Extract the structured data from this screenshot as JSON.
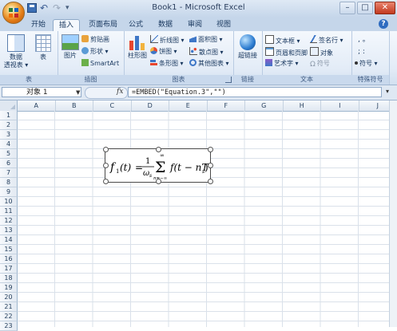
{
  "window": {
    "title": "Book1 - Microsoft Excel",
    "min": "–",
    "max": "□",
    "close": "✕"
  },
  "qat": {
    "undo": "↶",
    "redo": "↷",
    "more": "▾"
  },
  "tabs": [
    "开始",
    "插入",
    "页面布局",
    "公式",
    "数据",
    "审阅",
    "视图"
  ],
  "active_tab": "插入",
  "help": "?",
  "ribbon": {
    "groups": {
      "table": {
        "label": "表",
        "pivot": "数据\n透视表",
        "pivot_line1": "数据",
        "pivot_line2": "透视表 ▾",
        "table": "表"
      },
      "illustrations": {
        "label": "插图",
        "picture": "图片",
        "clipart": "剪贴画",
        "shapes": "形状 ▾",
        "smartart": "SmartArt"
      },
      "charts": {
        "label": "图表",
        "column": "柱形图",
        "line": "折线图 ▾",
        "pie": "饼图 ▾",
        "bar": "条形图 ▾",
        "area": "面积图 ▾",
        "scatter": "散点图 ▾",
        "other": "其他图表 ▾"
      },
      "links": {
        "label": "链接",
        "hyperlink": "超链接"
      },
      "text": {
        "label": "文本",
        "textbox": "文本框 ▾",
        "header_footer": "页眉和页脚",
        "wordart": "艺术字 ▾",
        "signature": "签名行 ▾",
        "object": "对象",
        "symbol": "符号"
      },
      "special": {
        "label": "特殊符号",
        "row1": ",  。",
        "row2": ";  :",
        "more": "符号 ▾"
      }
    }
  },
  "formula_bar": {
    "name_box": "对象 1",
    "fx": "fx",
    "formula": "=EMBED(\"Equation.3\",\"\")",
    "expand": "▾"
  },
  "sheet": {
    "columns": [
      "A",
      "B",
      "C",
      "D",
      "E",
      "F",
      "G",
      "H",
      "I",
      "J"
    ],
    "rows": [
      "1",
      "2",
      "3",
      "4",
      "5",
      "6",
      "7",
      "8",
      "9",
      "10",
      "11",
      "12",
      "13",
      "14",
      "15",
      "16",
      "17",
      "18",
      "19",
      "20",
      "21",
      "22",
      "23"
    ]
  },
  "equation": {
    "f": "f",
    "sub1": "1",
    "t_open": "(t)",
    "eq": "=",
    "num": "1",
    "omega": "ω",
    "sub_s": "s",
    "sigma": "Σ",
    "sum_top": "∞",
    "sum_bottom": "n=−∞",
    "body": "f(t − nT",
    "body_sub": "s",
    "body_close": ")"
  },
  "colors": {
    "ribbon_bg": "#e3ecf7",
    "title_bg": "#c5d6ea",
    "grid_line": "#dae1ea",
    "header_text": "#27415f"
  }
}
